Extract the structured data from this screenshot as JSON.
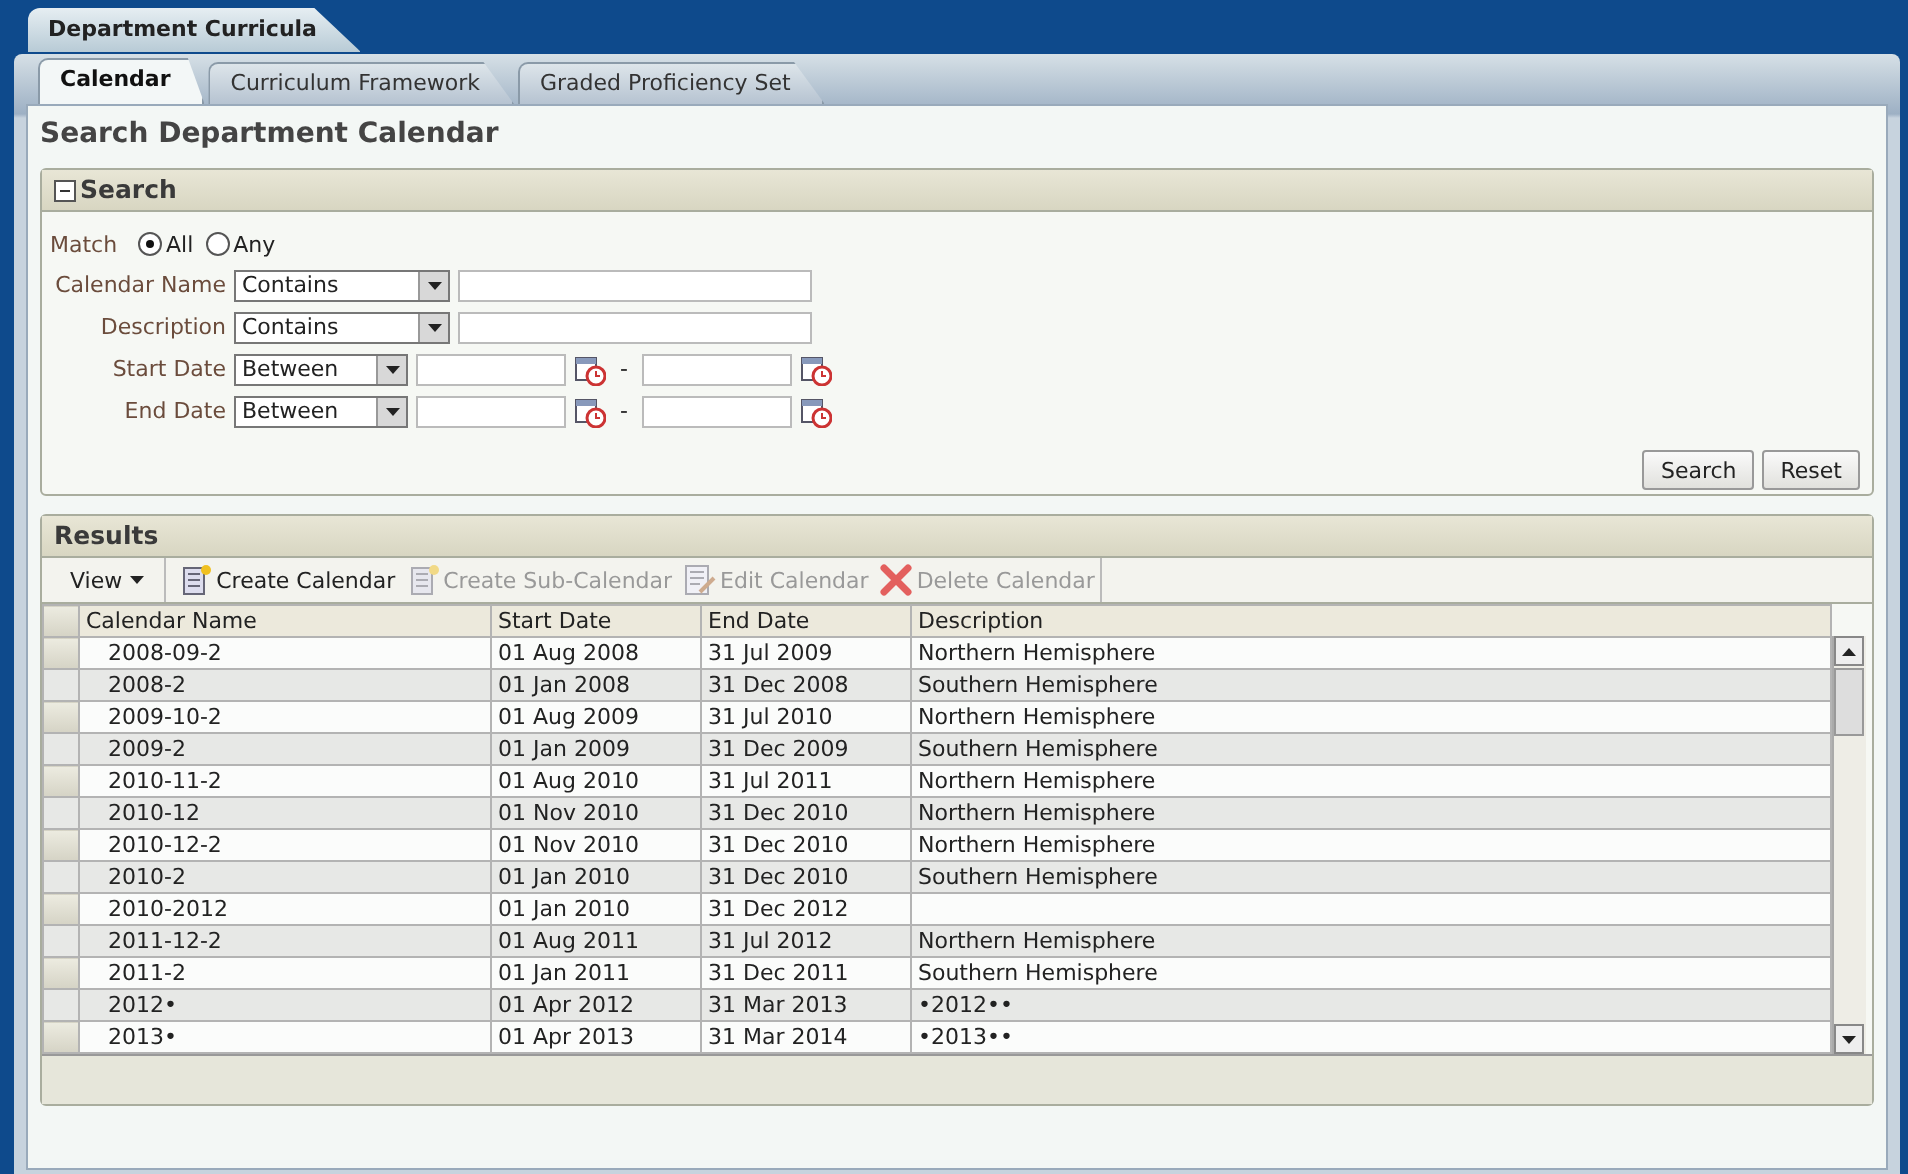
{
  "app_tab": {
    "label": "Department Curricula"
  },
  "tabs": [
    {
      "label": "Calendar",
      "selected": true
    },
    {
      "label": "Curriculum Framework",
      "selected": false
    },
    {
      "label": "Graded Proficiency Set",
      "selected": false
    }
  ],
  "page_title": "Search Department Calendar",
  "search": {
    "title": "Search",
    "expanded": true,
    "match_label": "Match",
    "match_options": [
      {
        "label": "All",
        "selected": true
      },
      {
        "label": "Any",
        "selected": false
      }
    ],
    "fields": [
      {
        "kind": "text",
        "label": "Calendar Name",
        "operator": "Contains"
      },
      {
        "kind": "text",
        "label": "Description",
        "operator": "Contains"
      },
      {
        "kind": "range",
        "label": "Start Date",
        "operator": "Between",
        "separator": "-"
      },
      {
        "kind": "range",
        "label": "End Date",
        "operator": "Between",
        "separator": "-"
      }
    ],
    "buttons": [
      "Search",
      "Reset"
    ]
  },
  "results": {
    "title": "Results",
    "view_menu": "View",
    "actions": [
      {
        "kind": "create",
        "label": "Create Calendar",
        "disabled": false
      },
      {
        "kind": "create",
        "label": "Create Sub-Calendar",
        "disabled": true
      },
      {
        "kind": "edit",
        "label": "Edit Calendar",
        "disabled": true
      },
      {
        "kind": "delete",
        "label": "Delete Calendar",
        "disabled": true
      }
    ],
    "columns": [
      "Calendar Name",
      "Start Date",
      "End Date",
      "Description"
    ],
    "rows": [
      [
        "2008-09-2",
        "01 Aug 2008",
        "31 Jul 2009",
        "Northern Hemisphere"
      ],
      [
        "2008-2",
        "01 Jan 2008",
        "31 Dec 2008",
        "Southern Hemisphere"
      ],
      [
        "2009-10-2",
        "01 Aug 2009",
        "31 Jul 2010",
        "Northern Hemisphere"
      ],
      [
        "2009-2",
        "01 Jan 2009",
        "31 Dec 2009",
        "Southern Hemisphere"
      ],
      [
        "2010-11-2",
        "01 Aug 2010",
        "31 Jul 2011",
        "Northern Hemisphere"
      ],
      [
        "2010-12",
        "01 Nov 2010",
        "31 Dec 2010",
        "Northern Hemisphere"
      ],
      [
        "2010-12-2",
        "01 Nov 2010",
        "31 Dec 2010",
        "Northern Hemisphere"
      ],
      [
        "2010-2",
        "01 Jan 2010",
        "31 Dec 2010",
        "Southern Hemisphere"
      ],
      [
        "2010-2012",
        "01 Jan 2010",
        "31 Dec 2012",
        ""
      ],
      [
        "2011-12-2",
        "01 Aug 2011",
        "31 Jul 2012",
        "Northern Hemisphere"
      ],
      [
        "2011-2",
        "01 Jan 2011",
        "31 Dec 2011",
        "Southern Hemisphere"
      ],
      [
        "2012•",
        "01 Apr 2012",
        "31 Mar 2013",
        "•2012••"
      ],
      [
        "2013•",
        "01 Apr 2013",
        "31 Mar 2014",
        "•2013••"
      ]
    ]
  }
}
